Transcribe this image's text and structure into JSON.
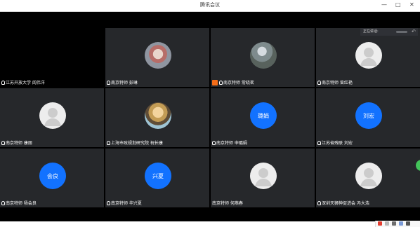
{
  "window": {
    "title": "腾讯会议"
  },
  "speaking": {
    "label": "正在讲话:"
  },
  "participants": [
    {
      "name": "江苏开放大学 闾伟洋",
      "type": "empty"
    },
    {
      "name": "南京特师 彭琳",
      "type": "photo1"
    },
    {
      "name": "南京特师 常晓茗",
      "type": "photo2",
      "host": true
    },
    {
      "name": "南京特师 曾红艳",
      "type": "gray"
    },
    {
      "name": "南京特师 康丽",
      "type": "gray"
    },
    {
      "name": "上海市政规划研究院 祝长康",
      "type": "photo3"
    },
    {
      "name": "南京特师 申璐娟",
      "type": "blue",
      "initials": "璐娟"
    },
    {
      "name": "江苏省残联 刘宏",
      "type": "blue",
      "initials": "刘宏"
    },
    {
      "name": "南京特师 杨会良",
      "type": "blue",
      "initials": "会良"
    },
    {
      "name": "南京特师 华兴夏",
      "type": "blue",
      "initials": "兴夏"
    },
    {
      "name": "南京特师 何燕春",
      "type": "gray"
    },
    {
      "name": "深圳天狮神促进会 冯大浩",
      "type": "gray"
    }
  ]
}
